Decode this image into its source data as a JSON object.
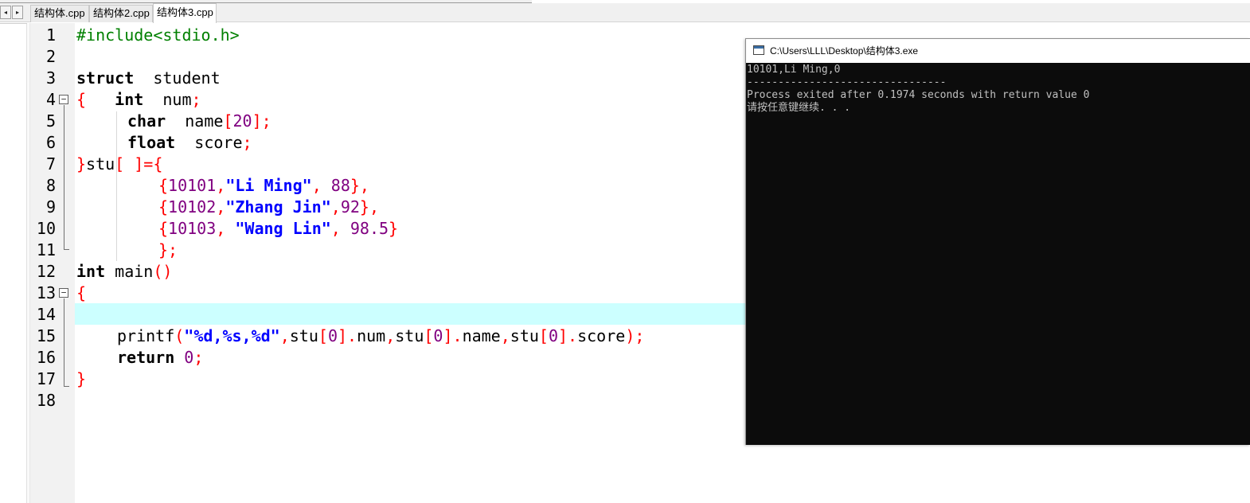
{
  "tabs": [
    {
      "label": "结构体.cpp",
      "active": false
    },
    {
      "label": "结构体2.cpp",
      "active": false
    },
    {
      "label": "结构体3.cpp",
      "active": true
    }
  ],
  "tab_scroll": {
    "left": "◂",
    "right": "▸"
  },
  "editor": {
    "line_numbers": [
      "1",
      "2",
      "3",
      "4",
      "5",
      "6",
      "7",
      "8",
      "9",
      "10",
      "11",
      "12",
      "13",
      "14",
      "15",
      "16",
      "17",
      "18"
    ],
    "current_line": 14,
    "fold_markers": {
      "collapse": "−"
    },
    "code": {
      "l1_pre": "#include<stdio.h>",
      "l3_kw": "struct",
      "l3_id": "  student",
      "l4_brace": "{",
      "l4_sp": "   ",
      "l4_kw": "int",
      "l4_id": "  num",
      "l4_semi": ";",
      "l5_kw": "char",
      "l5_id": "  name",
      "l5_br1": "[",
      "l5_num": "20",
      "l5_br2": "];",
      "l6_kw": "float",
      "l6_id": "  score",
      "l6_semi": ";",
      "l7_brace": "}",
      "l7_id": "stu",
      "l7_rest": "[ ]={",
      "l8_brace": "{",
      "l8_num": "10101",
      "l8_comma": ",",
      "l8_str": "\"Li Ming\"",
      "l8_comma2": ", ",
      "l8_num2": "88",
      "l8_end": "},",
      "l9_brace": "{",
      "l9_num": "10102",
      "l9_comma": ",",
      "l9_str": "\"Zhang Jin\"",
      "l9_comma2": ",",
      "l9_num2": "92",
      "l9_end": "},",
      "l10_brace": "{",
      "l10_num": "10103",
      "l10_comma": ", ",
      "l10_str": "\"Wang Lin\"",
      "l10_comma2": ", ",
      "l10_num2": "98.5",
      "l10_end": "}",
      "l11_end": "};",
      "l12_kw": "int",
      "l12_id": " main",
      "l12_paren": "()",
      "l13_brace": "{",
      "l15_fn": "printf",
      "l15_p1": "(",
      "l15_str": "\"%d,%s,%d\"",
      "l15_c1": ",",
      "l15_a1": "stu",
      "l15_b1": "[",
      "l15_n1": "0",
      "l15_b1e": "].",
      "l15_f1": "num",
      "l15_c2": ",",
      "l15_a2": "stu",
      "l15_b2": "[",
      "l15_n2": "0",
      "l15_b2e": "].",
      "l15_f2": "name",
      "l15_c3": ",",
      "l15_a3": "stu",
      "l15_b3": "[",
      "l15_n3": "0",
      "l15_b3e": "].",
      "l15_f3": "score",
      "l15_end": ");",
      "l16_kw": "return",
      "l16_num": " 0",
      "l16_semi": ";",
      "l17_brace": "}"
    }
  },
  "console": {
    "title": "C:\\Users\\LLL\\Desktop\\结构体3.exe",
    "lines": [
      "10101,Li Ming,0",
      "--------------------------------",
      "Process exited after 0.1974 seconds with return value 0",
      "请按任意键继续. . ."
    ]
  },
  "colors": {
    "keyword": "#000000",
    "preprocessor": "#008000",
    "punctuation": "#ff0000",
    "string": "#0000ff",
    "number": "#800080",
    "current_line_bg": "#ccffff",
    "console_bg": "#0c0c0c",
    "console_fg": "#c0c0c0"
  }
}
